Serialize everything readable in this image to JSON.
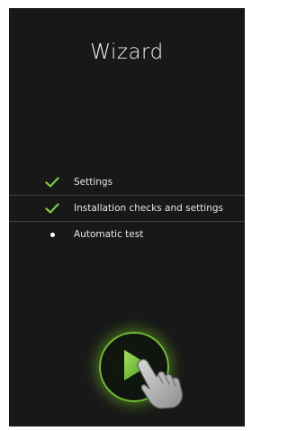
{
  "window": {
    "title": "Wizard"
  },
  "steps": [
    {
      "label": "Settings",
      "status": "completed",
      "icon": "check-icon"
    },
    {
      "label": "Installation checks and settings",
      "status": "completed",
      "icon": "check-icon"
    },
    {
      "label": "Automatic test",
      "status": "pending",
      "icon": "bullet-icon"
    }
  ],
  "actions": {
    "start_icon": "play-icon",
    "pointer_icon": "hand-pointer-icon"
  },
  "colors": {
    "background": "#181818",
    "accent": "#6fbf2f",
    "text": "#e6e6e6"
  }
}
